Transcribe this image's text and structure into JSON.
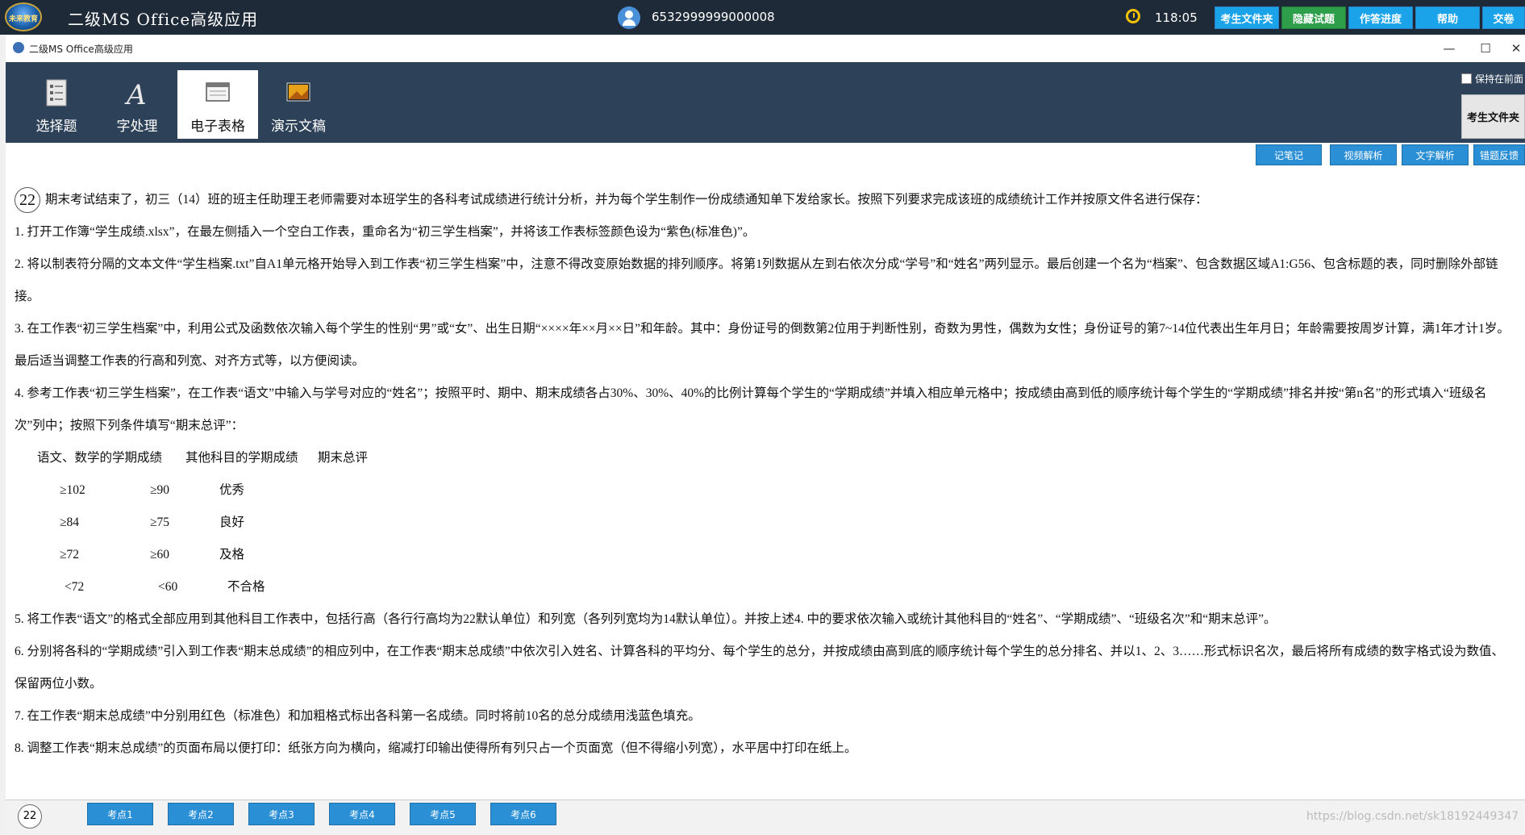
{
  "topbar": {
    "logo_text": "未来教育",
    "title": "二级MS Office高级应用",
    "exam_id": "6532999999000008",
    "timer": "118:05",
    "buttons": [
      "考生文件夹",
      "隐藏试题",
      "作答进度",
      "帮助",
      "交卷"
    ]
  },
  "window": {
    "title": "二级MS Office高级应用",
    "min": "—",
    "max": "☐",
    "close": "✕"
  },
  "ribbon": {
    "tabs": [
      "选择题",
      "字处理",
      "电子表格",
      "演示文稿"
    ],
    "active_tab": "电子表格",
    "keep_front": "保持在前面",
    "side_button": "考生文件夹"
  },
  "actions": [
    "记笔记",
    "视频解析",
    "文字解析",
    "错题反馈"
  ],
  "question": {
    "number": "22",
    "intro": "期末考试结束了，初三（14）班的班主任助理王老师需要对本班学生的各科考试成绩进行统计分析，并为每个学生制作一份成绩通知单下发给家长。按照下列要求完成该班的成绩统计工作并按原文件名进行保存：",
    "items": [
      "1. 打开工作簿“学生成绩.xlsx”，在最左侧插入一个空白工作表，重命名为“初三学生档案”，并将该工作表标签颜色设为“紫色(标准色)”。",
      "2. 将以制表符分隔的文本文件“学生档案.txt”自A1单元格开始导入到工作表“初三学生档案”中，注意不得改变原始数据的排列顺序。将第1列数据从左到右依次分成“学号”和“姓名”两列显示。最后创建一个名为“档案”、包含数据区域A1:G56、包含标题的表，同时删除外部链接。",
      "3. 在工作表“初三学生档案”中，利用公式及函数依次输入每个学生的性别“男”或“女”、出生日期“××××年××月××日”和年龄。其中：身份证号的倒数第2位用于判断性别，奇数为男性，偶数为女性；身份证号的第7~14位代表出生年月日；年龄需要按周岁计算，满1年才计1岁。最后适当调整工作表的行高和列宽、对齐方式等，以方便阅读。",
      "4. 参考工作表“初三学生档案”，在工作表“语文”中输入与学号对应的“姓名”；按照平时、期中、期末成绩各占30%、30%、40%的比例计算每个学生的“学期成绩”并填入相应单元格中；按成绩由高到低的顺序统计每个学生的“学期成绩”排名并按“第n名”的形式填入“班级名次”列中；按照下列条件填写“期末总评”："
    ],
    "table": {
      "header": [
        "语文、数学的学期成绩",
        "其他科目的学期成绩",
        "期末总评"
      ],
      "rows": [
        [
          "≥102",
          "≥90",
          "优秀"
        ],
        [
          "≥84",
          "≥75",
          "良好"
        ],
        [
          "≥72",
          "≥60",
          "及格"
        ],
        [
          "<72",
          "<60",
          "不合格"
        ]
      ]
    },
    "items_after": [
      "5. 将工作表“语文”的格式全部应用到其他科目工作表中，包括行高（各行行高均为22默认单位）和列宽（各列列宽均为14默认单位）。并按上述4. 中的要求依次输入或统计其他科目的“姓名”、“学期成绩”、“班级名次”和“期末总评”。",
      "6. 分别将各科的“学期成绩”引入到工作表“期末总成绩”的相应列中，在工作表“期末总成绩”中依次引入姓名、计算各科的平均分、每个学生的总分，并按成绩由高到底的顺序统计每个学生的总分排名、并以1、2、3……形式标识名次，最后将所有成绩的数字格式设为数值、保留两位小数。",
      "7. 在工作表“期末总成绩”中分别用红色（标准色）和加粗格式标出各科第一名成绩。同时将前10名的总分成绩用浅蓝色填充。",
      "8. 调整工作表“期末总成绩”的页面布局以便打印：纸张方向为横向，缩减打印输出使得所有列只占一个页面宽（但不得缩小列宽），水平居中打印在纸上。"
    ]
  },
  "bottom": {
    "number": "22",
    "points": [
      "考点1",
      "考点2",
      "考点3",
      "考点4",
      "考点5",
      "考点6"
    ],
    "watermark": "https://blog.csdn.net/sk18192449347"
  },
  "colors": {
    "topbar": "#1e2a38",
    "ribbon": "#2d4158",
    "accent": "#2b8fd6",
    "hide_button": "#2e9e4a"
  }
}
